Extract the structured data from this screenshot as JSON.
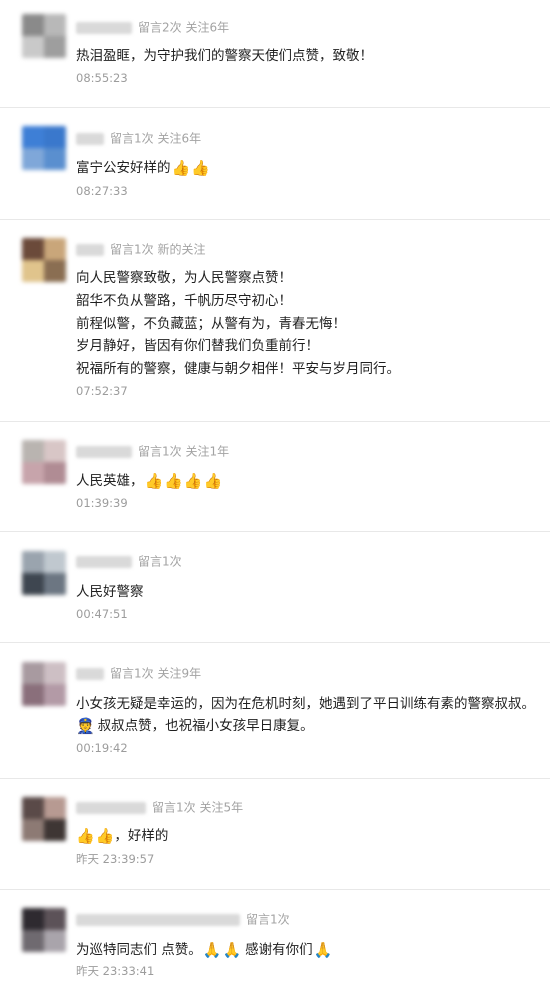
{
  "comments": [
    {
      "meta": "留言2次 关注6年",
      "lines": [
        "热泪盈眶，为守护我们的警察天使们点赞，致敬！"
      ],
      "time": "08:55:23"
    },
    {
      "meta": "留言1次 关注6年",
      "lines": [
        "富宁公安好样的"
      ],
      "emoji": "thumbs-up-icon x2",
      "time": "08:27:33"
    },
    {
      "meta": "留言1次 新的关注",
      "lines": [
        "向人民警察致敬，为人民警察点赞！",
        "韶华不负从警路，千帆历尽守初心！",
        "前程似警，不负藏蓝；从警有为，青春无悔！",
        "岁月静好，皆因有你们替我们负重前行！",
        "祝福所有的警察，健康与朝夕相伴！平安与岁月同行。"
      ],
      "time": "07:52:37"
    },
    {
      "meta": "留言1次 关注1年",
      "lines": [
        "人民英雄，"
      ],
      "emoji": "thumbs-up-icon x4",
      "time": "01:39:39"
    },
    {
      "meta": "留言1次",
      "lines": [
        "人民好警察"
      ],
      "time": "00:47:51"
    },
    {
      "meta": "留言1次 关注9年",
      "lines": [
        "小女孩无疑是幸运的，因为在危机时刻，她遇到了平日训练有素的警察叔叔。",
        "叔叔点赞，也祝福小女孩早日康复。"
      ],
      "emoji": "police-officer-icon",
      "time": "00:19:42"
    },
    {
      "meta": "留言1次 关注5年",
      "lines": [
        "，好样的"
      ],
      "emoji": "thumbs-up-icon x2",
      "time": "昨天 23:39:57"
    },
    {
      "meta": "留言1次",
      "lines": [
        "为巡特同志们 点赞。",
        "感谢有你们"
      ],
      "emoji": "pray-icon x3",
      "time": "昨天 23:33:41"
    }
  ],
  "colors": {
    "text": "#1f1f1f",
    "meta": "#a3a3a3",
    "time": "#9c9c9c",
    "divider": "#e8e8e8"
  }
}
